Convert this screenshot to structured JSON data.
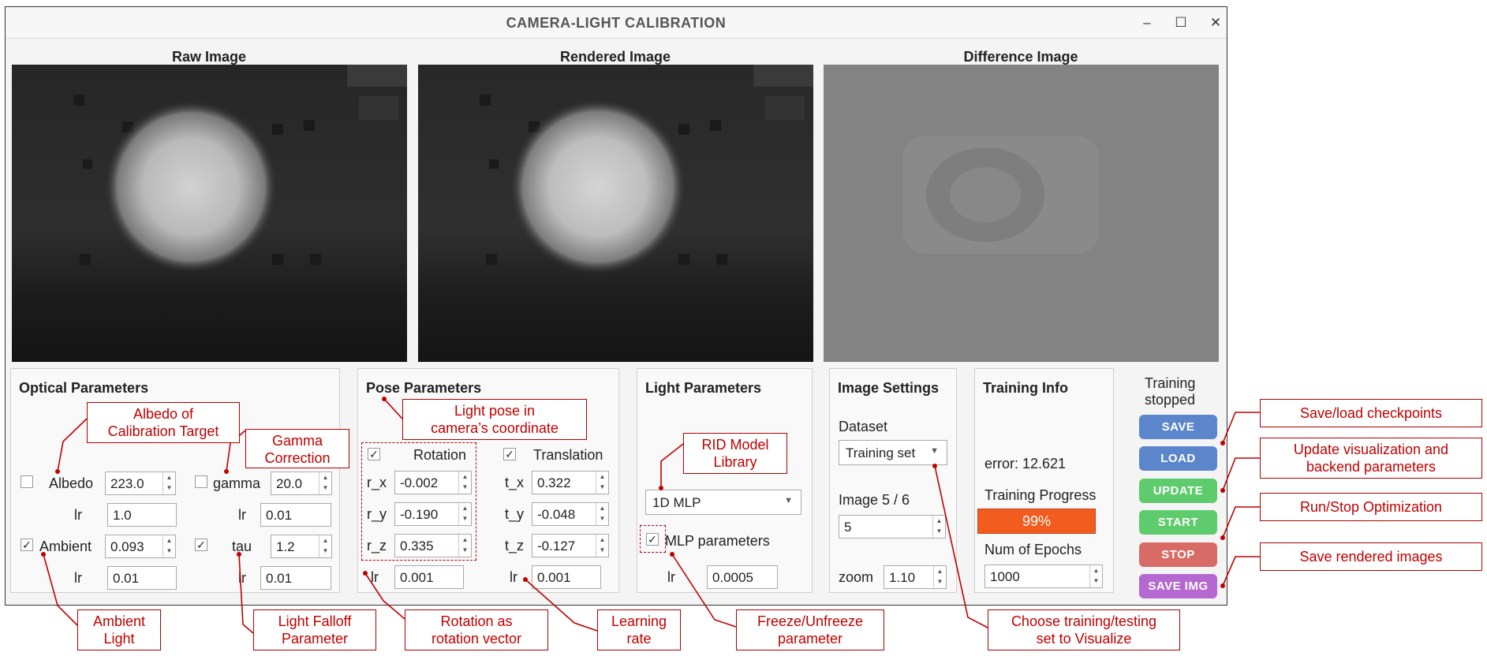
{
  "window": {
    "title": "CAMERA-LIGHT CALIBRATION",
    "controls": {
      "minimize": "–",
      "maximize": "☐",
      "close": "✕"
    }
  },
  "images": {
    "raw_label": "Raw Image",
    "rendered_label": "Rendered Image",
    "difference_label": "Difference Image"
  },
  "optical": {
    "title": "Optical Parameters",
    "albedo": {
      "label": "Albedo",
      "checked": false,
      "value": "223.0",
      "lr_label": "lr",
      "lr": "1.0"
    },
    "gamma": {
      "label": "gamma",
      "checked": false,
      "value": "20.0",
      "lr_label": "lr",
      "lr": "0.01"
    },
    "ambient": {
      "label": "Ambient",
      "checked": true,
      "value": "0.093",
      "lr_label": "lr",
      "lr": "0.01"
    },
    "tau": {
      "label": "tau",
      "checked": true,
      "value": "1.2",
      "lr_label": "lr",
      "lr": "0.01"
    }
  },
  "pose": {
    "title": "Pose Parameters",
    "rotation_label": "Rotation",
    "translation_label": "Translation",
    "rotation_checked": true,
    "translation_checked": true,
    "r_x_label": "r_x",
    "r_x": "-0.002",
    "r_y_label": "r_y",
    "r_y": "-0.190",
    "r_z_label": "r_z",
    "r_z": "0.335",
    "t_x_label": "t_x",
    "t_x": "0.322",
    "t_y_label": "t_y",
    "t_y": "-0.048",
    "t_z_label": "t_z",
    "t_z": "-0.127",
    "lr_label": "lr",
    "rot_lr": "0.001",
    "trans_lr": "0.001"
  },
  "light": {
    "title": "Light Parameters",
    "model": "1D MLP",
    "mlp_label": "MLP parameters",
    "mlp_checked": true,
    "lr_label": "lr",
    "lr": "0.0005"
  },
  "image_settings": {
    "title": "Image Settings",
    "dataset_label": "Dataset",
    "dataset": "Training set",
    "image_label": "Image 5 / 6",
    "image_value": "5",
    "zoom_label": "zoom",
    "zoom_value": "1.10"
  },
  "training_info": {
    "title": "Training Info",
    "error": "error: 12.621",
    "progress_label": "Training Progress",
    "progress_text": "99%",
    "progress_fraction": 0.99,
    "epochs_label": "Num of Epochs",
    "epochs_value": "1000"
  },
  "status": {
    "line1": "Training",
    "line2": "stopped"
  },
  "buttons": {
    "save": "SAVE",
    "load": "LOAD",
    "update": "UPDATE",
    "start": "START",
    "stop": "STOP",
    "save_img": "SAVE IMG"
  },
  "annotations": {
    "albedo_l1": "Albedo of",
    "albedo_l2": "Calibration Target",
    "gamma_l1": "Gamma",
    "gamma_l2": "Correction",
    "pose_l1": "Light pose in",
    "pose_l2": "camera’s coordinate",
    "rid_l1": "RID Model",
    "rid_l2": "Library",
    "ambient_l1": "Ambient",
    "ambient_l2": "Light",
    "falloff_l1": "Light Falloff",
    "falloff_l2": "Parameter",
    "rotvec_l1": "Rotation as",
    "rotvec_l2": "rotation vector",
    "lr_l1": "Learning",
    "lr_l2": "rate",
    "freeze_l1": "Freeze/Unfreeze",
    "freeze_l2": "parameter",
    "dataset_l1": "Choose training/testing",
    "dataset_l2": "set to Visualize",
    "saveload": "Save/load checkpoints",
    "update_l1": "Update visualization and",
    "update_l2": "backend parameters",
    "runstop": "Run/Stop Optimization",
    "saveimg": "Save rendered images"
  },
  "colors": {
    "save": "#5b86cc",
    "load": "#5b86cc",
    "update": "#5ecb6d",
    "start": "#5ecb6d",
    "stop": "#d96b66",
    "save_img": "#b468d0",
    "progress": "#f25c1e",
    "annotation": "#c00000"
  }
}
